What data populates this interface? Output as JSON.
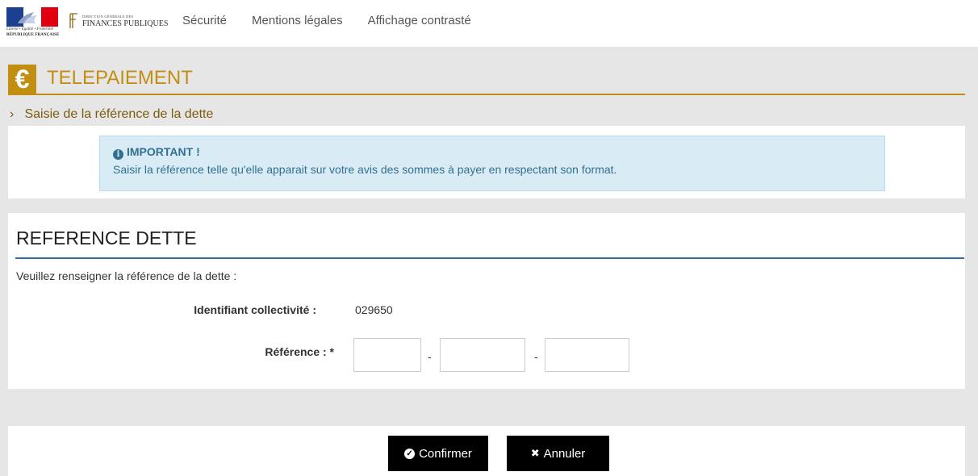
{
  "header": {
    "logo_rf": {
      "motto": "Liberté • Égalité • Fraternité",
      "name": "RÉPUBLIQUE FRANÇAISE"
    },
    "logo_dgfip": {
      "small": "DIRECTION GÉNÉRALE DES",
      "big": "FINANCES PUBLIQUES"
    },
    "nav": [
      "Sécurité",
      "Mentions légales",
      "Affichage contrasté"
    ]
  },
  "app": {
    "currency_glyph": "€",
    "title": "TELEPAIEMENT",
    "breadcrumb_chevron": "›",
    "breadcrumb": "Saisie de la référence de la dette"
  },
  "alert": {
    "icon": "info-circle-icon",
    "title": "IMPORTANT !",
    "text": "Saisir la référence telle qu'elle apparait sur votre avis des sommes à payer en respectant son format."
  },
  "reference": {
    "section_title": "REFERENCE DETTE",
    "intro": "Veuillez renseigner la référence de la dette :",
    "collectivite_label": "Identifiant collectivité :",
    "collectivite_value": "029650",
    "reference_label": "Référence :  *",
    "separator": "-",
    "inputs": [
      "",
      "",
      ""
    ]
  },
  "actions": {
    "confirm_label": "Confirmer",
    "cancel_label": "Annuler",
    "cancel_glyph": "✖"
  },
  "colors": {
    "accent_gold": "#c28e12",
    "alert_bg": "#d9ecf6",
    "alert_text": "#31708f",
    "section_rule": "#2b6fa8",
    "page_gray": "#e6e6e6"
  }
}
